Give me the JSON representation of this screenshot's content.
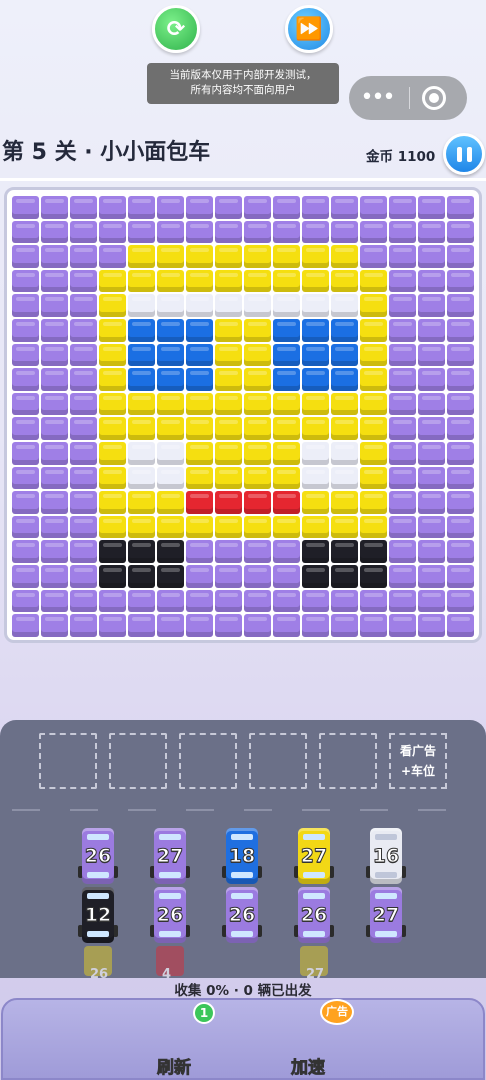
{
  "system": {
    "notice_line1": "当前版本仅用于内部开发测试，",
    "notice_line2": "所有内容均不面向用户",
    "more_icon": "•••",
    "close_icon": "target-icon"
  },
  "header": {
    "level_title": "第 5 关 · 小小面包车",
    "coins": "金币 1100"
  },
  "colors": {
    "P": "#9f7fe6",
    "Y": "#f5df10",
    "W": "#eceef8",
    "B": "#1b6fe3",
    "R": "#e52630",
    "K": "#1f1f27"
  },
  "pixel_art": [
    "PPPPPPPPPPPPPPPP",
    "PPPPPPPPPPPPPPPP",
    "PPPPYYYYYYYYPPPP",
    "PPPYYYYYYYYYYPPP",
    "PPPYWWWWWWWWYPPP",
    "PPPYBBBYYBBBYPPP",
    "PPPYBBBYYBBBYPPP",
    "PPPYBBBYYBBBYPPP",
    "PPPYYYYYYYYYYPPP",
    "PPPYYYYYYYYYYPPP",
    "PPPYWWYYYYWWYPPP",
    "PPPYWWYYYYWWYPPP",
    "PPPYYYRRRRYYYPPP",
    "PPPYYYYYYYYYYPPP",
    "PPPKKKPPPPKKKPPP",
    "PPPKKKPPPPKKKPPP",
    "PPPPPPPPPPPPPPPP",
    "PPPPPPPPPPPPPPPP"
  ],
  "parking": {
    "ad_line1": "看广告",
    "ad_line2": "+车位"
  },
  "cars": [
    {
      "number": "26",
      "color": "#9b7be0"
    },
    {
      "number": "27",
      "color": "#9b7be0"
    },
    {
      "number": "18",
      "color": "#1f6fe0"
    },
    {
      "number": "27",
      "color": "#f2d816"
    },
    {
      "number": "16",
      "color": "#e9ebf3"
    },
    {
      "number": "12",
      "color": "#1f1f27"
    },
    {
      "number": "26",
      "color": "#9b7be0"
    },
    {
      "number": "26",
      "color": "#9b7be0"
    },
    {
      "number": "26",
      "color": "#9b7be0"
    },
    {
      "number": "27",
      "color": "#9b7be0"
    }
  ],
  "queued": [
    {
      "number": "26",
      "color": "#f2d816"
    },
    {
      "number": "4",
      "color": "#e52630"
    },
    {
      "number": "27",
      "color": "#f2d816"
    }
  ],
  "stats": "收集 0% · 0 辆已出发",
  "buttons": {
    "refresh_label": "刷新",
    "refresh_badge": "1",
    "speed_label": "加速",
    "speed_badge": "广告"
  }
}
